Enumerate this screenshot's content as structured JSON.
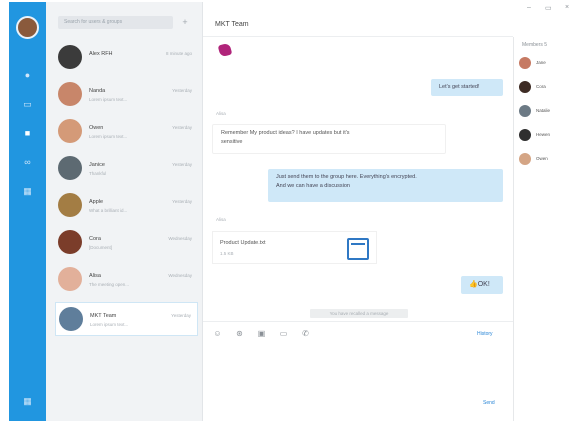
{
  "window": {
    "minimize": "–",
    "maximize": "▭",
    "close": "×"
  },
  "search": {
    "placeholder": "Search for users & groups"
  },
  "conversations": [
    {
      "name": "Alex RFH",
      "time": "8 minute ago",
      "snippet": "",
      "color": "#3b3b3b"
    },
    {
      "name": "Nanda",
      "time": "Yesterday",
      "snippet": "Lorem ipsum text...",
      "color": "#c8866a"
    },
    {
      "name": "Owen",
      "time": "Yesterday",
      "snippet": "Lorem ipsum text...",
      "color": "#d49a78"
    },
    {
      "name": "Janice",
      "time": "Yesterday",
      "snippet": "Thankful",
      "color": "#5d6a72"
    },
    {
      "name": "Apple",
      "time": "Yesterday",
      "snippet": "What a brilliant id...",
      "color": "#a37d44"
    },
    {
      "name": "Cora",
      "time": "Wednesday",
      "snippet": "[Document]",
      "color": "#7b3d2a"
    },
    {
      "name": "Alisa",
      "time": "Wednesday",
      "snippet": "The meeting open...",
      "color": "#e2b09a"
    },
    {
      "name": "MKT Team",
      "time": "Yesterday",
      "snippet": "Lorem ipsum text...",
      "color": "#5f7e9b"
    }
  ],
  "chat": {
    "title": "MKT Team",
    "messages": {
      "m1": "Let's get started!",
      "sender1": "Alisa",
      "m2_line1": "Remember My product ideas? I have updates but it's",
      "m2_line2": "sensitive",
      "m3_line1": "Just send them to the group here. Everything's encrypted.",
      "m3_line2": "And we can have a discussion",
      "sender2": "Alisa",
      "file_name": "Product Update.txt",
      "file_size": "1.5 KB",
      "reaction": "👍OK!",
      "recall_notice": "You have recalled a message"
    },
    "toolbar": {
      "history": "History",
      "send": "Send"
    }
  },
  "members": {
    "title": "Members  5",
    "list": [
      {
        "name": "Jane",
        "color": "#c67a63"
      },
      {
        "name": "Cora",
        "color": "#3e2c25"
      },
      {
        "name": "Natalie",
        "color": "#6c7a85"
      },
      {
        "name": "Hewen",
        "color": "#2f2f2f"
      },
      {
        "name": "Owen",
        "color": "#d4a585"
      }
    ]
  },
  "colors": {
    "accent": "#2196e0",
    "bubble_out": "#cfe8f8",
    "link": "#2b87d7"
  }
}
